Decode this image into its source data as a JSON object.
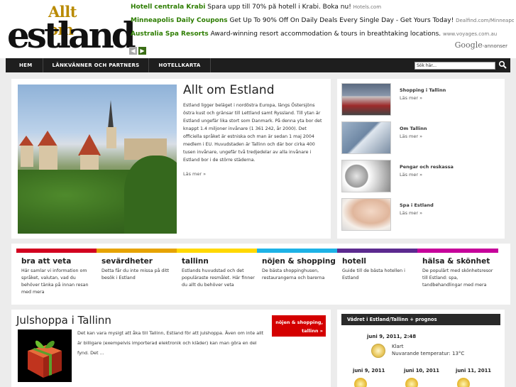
{
  "site": {
    "logo_small": "Allt om",
    "logo_big": "estland"
  },
  "ads": [
    {
      "title": "Hotell centrala Krabi",
      "text": "Spara upp till 70% på hotell i Krabi. Boka nu!",
      "url": "Hotels.com"
    },
    {
      "title": "Minneapolis Daily Coupons",
      "text": "Get Up To 90% Off On Daily Deals Every Single Day - Get Yours Today!",
      "url": "Dealfind.com/Minneapolis"
    },
    {
      "title": "Australia Spa Resorts",
      "text": "Award-winning resort accommodation & tours in breathtaking locations.",
      "url": "www.voyages.com.au"
    }
  ],
  "ad_nav": {
    "prev": "◀",
    "next": "▶"
  },
  "google": {
    "brand": "Google",
    "suffix": "-annonser"
  },
  "nav": {
    "items": [
      "HEM",
      "LÄNKVÄNNER OCH PARTNERS",
      "HOTELLKARTA"
    ],
    "search_placeholder": "Sök här..."
  },
  "feature": {
    "title": "Allt om Estland",
    "body": "Estland ligger beläget i nordöstra Europa, längs Östersjöns östra kust och gränsar till Lettland samt Ryssland. Till ytan är Estland ungefär lika stort som Danmark. På denna yta bor det knappt 1.4 miljoner invånare (1 361 242, år 2000). Det officiella språket är estniska och man är sedan 1 maj 2004 medlem i EU. Huvudstaden är Tallinn och där bor cirka 400 tusen invånare, ungefär två tredjedelar av alla invånare i Estland bor i de större städerna.",
    "more": "Läs mer »"
  },
  "side": [
    {
      "title": "Shopping i Tallinn",
      "more": "Läs mer »"
    },
    {
      "title": "Om Tallinn",
      "more": "Läs mer »"
    },
    {
      "title": "Pengar och reskassa",
      "more": "Läs mer »"
    },
    {
      "title": "Spa i Estland",
      "more": "Läs mer »"
    }
  ],
  "categories": [
    {
      "name": "bra att veta",
      "desc": "Här samlar vi information om språket, valutan, vad du behöver tänka på innan resan med mera",
      "color": "#d2001f"
    },
    {
      "name": "sevärdheter",
      "desc": "Detta får du inte missa på ditt besök i Estland",
      "color": "#e6a300"
    },
    {
      "name": "tallinn",
      "desc": "Estlands huvudstad och det populäraste resmålet. Här finner du allt du behöver veta",
      "color": "#ffd800"
    },
    {
      "name": "nöjen & shopping",
      "desc": "De bästa shoppinghusen, restaurangerna och barerna",
      "color": "#1db2e6"
    },
    {
      "name": "hotell",
      "desc": "Guide till de bästa hotellen i Estland",
      "color": "#5c2a8f"
    },
    {
      "name": "hälsa & skönhet",
      "desc": "De populärt med skönhetsresor till Estland: spa, tandbehandlingar med mera",
      "color": "#c6009a"
    }
  ],
  "category_extra_colors": [
    "#7dc242",
    "#1f3fa8"
  ],
  "article": {
    "title": "Julshoppa i Tallinn",
    "tag": "nöjen & shopping, tallinn »",
    "body": "Det kan vara mysigt att åka till Tallinn, Estland för att julshoppa. Även om inte allt är billigare (exempelvis importerad elektronik och kläder) kan man göra en del fynd. Det ..."
  },
  "weather": {
    "header": "Vädret i Estland/Tallinn + prognos",
    "current_date": "juni 9, 2011, 2:48",
    "condition": "Klart",
    "temperature": "Nuvarande temperatur: 13°C",
    "forecast": [
      "juni 9, 2011",
      "juni 10, 2011",
      "juni 11, 2011"
    ]
  }
}
